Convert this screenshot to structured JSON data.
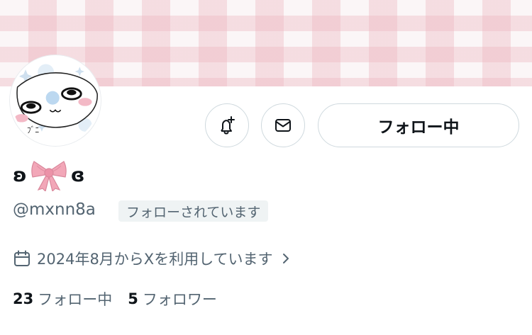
{
  "profile": {
    "display_name_left": "ʚ",
    "display_name_right": "ɞ",
    "handle": "@mxnn8a",
    "follows_you_badge": "フォローされています",
    "joined_text": "2024年8月からXを利用しています",
    "following_count": "23",
    "following_label": "フォロー中",
    "followers_count": "5",
    "followers_label": "フォロワー"
  },
  "actions": {
    "following_button_label": "フォロー中",
    "notify_icon": "bell-plus-icon",
    "message_icon": "envelope-icon"
  },
  "colors": {
    "text_primary": "#0f1419",
    "text_secondary": "#536471",
    "border": "#cfd9de",
    "badge_bg": "#eff3f4",
    "banner_check": "#ecb4be",
    "bow_pink": "#f2a7b8"
  }
}
